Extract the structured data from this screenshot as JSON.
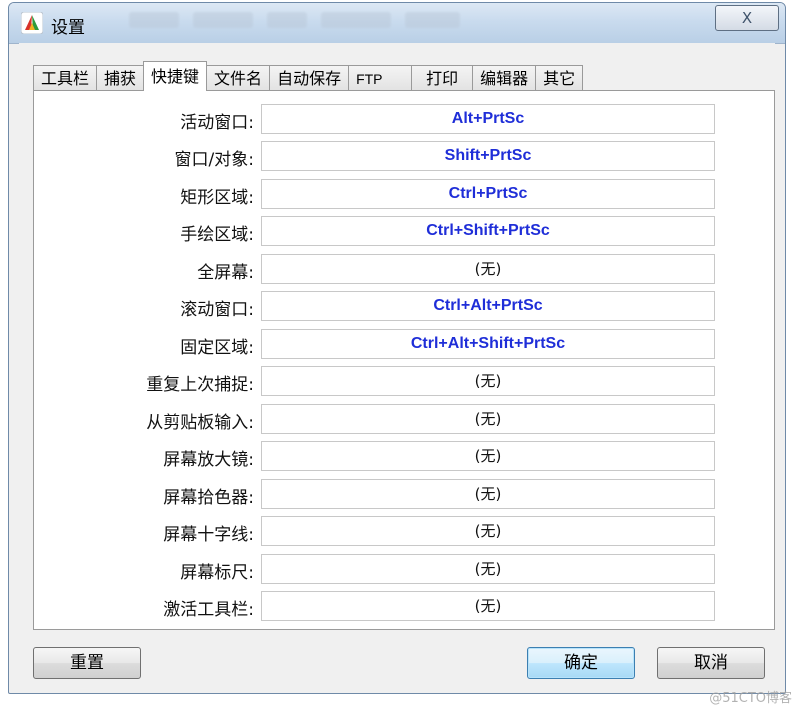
{
  "window": {
    "title": "设置",
    "close_label": "X"
  },
  "tabs": [
    {
      "label": "工具栏"
    },
    {
      "label": "捕获"
    },
    {
      "label": "快捷键",
      "active": true
    },
    {
      "label": "文件名"
    },
    {
      "label": "自动保存"
    },
    {
      "label": "FTP"
    },
    {
      "label": "打印"
    },
    {
      "label": "编辑器"
    },
    {
      "label": "其它"
    }
  ],
  "hotkeys": [
    {
      "label": "活动窗口:",
      "value": "Alt+PrtSc"
    },
    {
      "label": "窗口/对象:",
      "value": "Shift+PrtSc"
    },
    {
      "label": "矩形区域:",
      "value": "Ctrl+PrtSc"
    },
    {
      "label": "手绘区域:",
      "value": "Ctrl+Shift+PrtSc"
    },
    {
      "label": "全屏幕:",
      "value": "(无)"
    },
    {
      "label": "滚动窗口:",
      "value": "Ctrl+Alt+PrtSc"
    },
    {
      "label": "固定区域:",
      "value": "Ctrl+Alt+Shift+PrtSc"
    },
    {
      "label": "重复上次捕捉:",
      "value": "(无)"
    },
    {
      "label": "从剪贴板输入:",
      "value": "(无)"
    },
    {
      "label": "屏幕放大镜:",
      "value": "(无)"
    },
    {
      "label": "屏幕拾色器:",
      "value": "(无)"
    },
    {
      "label": "屏幕十字线:",
      "value": "(无)"
    },
    {
      "label": "屏幕标尺:",
      "value": "(无)"
    },
    {
      "label": "激活工具栏:",
      "value": "(无)"
    }
  ],
  "buttons": {
    "reset": "重置",
    "ok": "确定",
    "cancel": "取消"
  },
  "watermark": "@51CTO博客",
  "colors": {
    "hotkey_text": "#1f2ed8",
    "empty_text": "#111111"
  }
}
